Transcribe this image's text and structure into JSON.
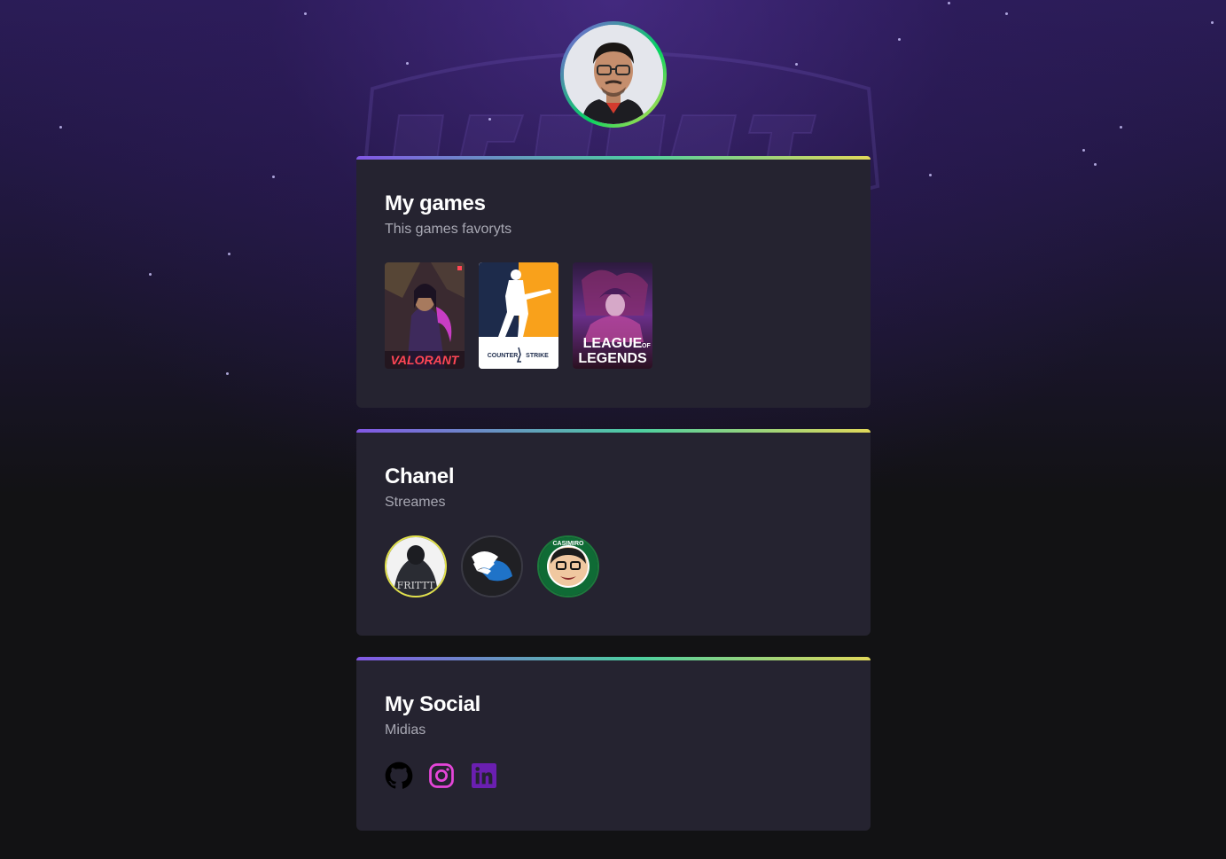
{
  "profile": {
    "avatar_alt": "profile photo"
  },
  "games_section": {
    "title": "My games",
    "subtitle": "This games favoryts",
    "items": [
      {
        "name": "VALORANT",
        "logo_text": "VALORANT",
        "color": "#ff4655"
      },
      {
        "name": "Counter-Strike",
        "logo_text_1": "COUNTER",
        "logo_text_2": "STRIKE",
        "color": "#f9a11b"
      },
      {
        "name": "League of Legends",
        "logo_text_1": "LEAGUE",
        "logo_text_of": "OF",
        "logo_text_2": "LEGENDS",
        "color": "#7a2fa8"
      }
    ]
  },
  "channel_section": {
    "title": "Chanel",
    "subtitle": "Streames",
    "items": [
      {
        "name": "Fritt",
        "label": "FRITTT",
        "border_color": "#e1e14a"
      },
      {
        "name": "Gaules",
        "border_color": "#3a3a44"
      },
      {
        "name": "Casimiro",
        "label": "CASIMIRO",
        "border_color": "#1c7a3c"
      }
    ]
  },
  "social_section": {
    "title": "My Social",
    "subtitle": "Midias",
    "items": [
      {
        "name": "github",
        "color": "#000000"
      },
      {
        "name": "instagram",
        "color": "#e546d9"
      },
      {
        "name": "linkedin",
        "color": "#6a1fb0"
      }
    ]
  }
}
